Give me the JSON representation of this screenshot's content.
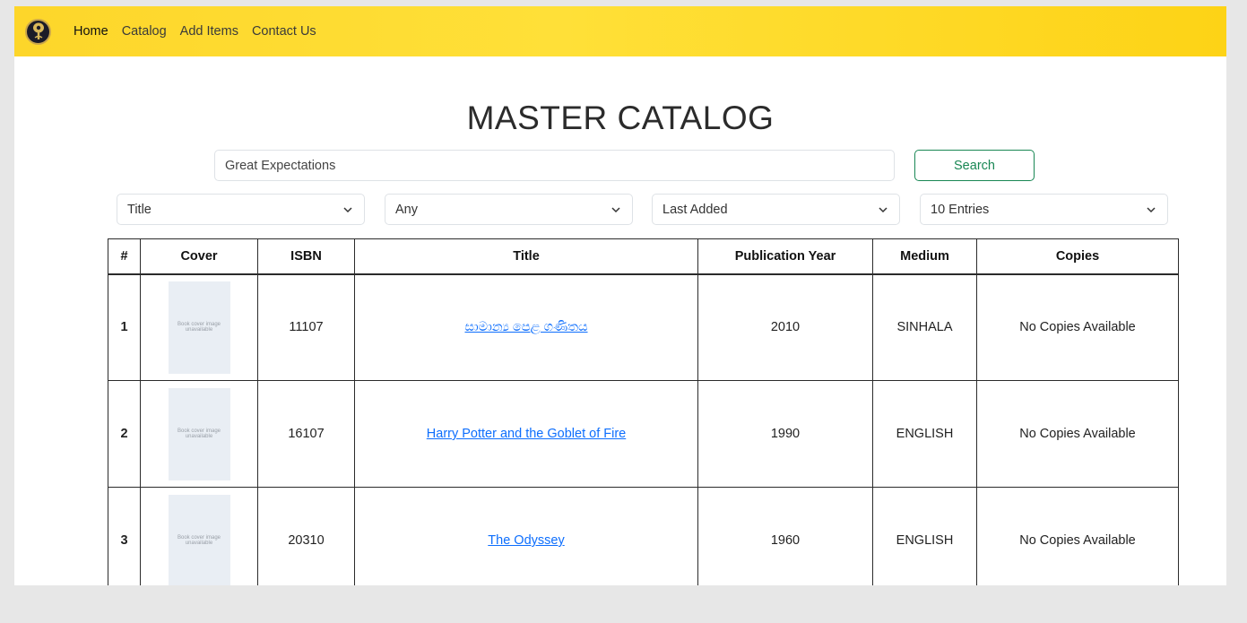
{
  "nav": {
    "links": [
      "Home",
      "Catalog",
      "Add Items",
      "Contact Us"
    ]
  },
  "page_title": "MASTER CATALOG",
  "search": {
    "value": "Great Expectations",
    "button_label": "Search"
  },
  "filters": {
    "search_by": "Title",
    "medium": "Any",
    "sort": "Last Added",
    "entries": "10 Entries"
  },
  "table": {
    "headers": [
      "#",
      "Cover",
      "ISBN",
      "Title",
      "Publication Year",
      "Medium",
      "Copies"
    ],
    "rows": [
      {
        "num": "1",
        "cover_text": "Book cover image unavailable",
        "isbn": "11107",
        "title": "සාමාන්‍ය පෙළ ගණිතය",
        "year": "2010",
        "medium": "SINHALA",
        "copies": "No Copies Available"
      },
      {
        "num": "2",
        "cover_text": "Book cover image unavailable",
        "isbn": "16107",
        "title": "Harry Potter and the Goblet of Fire",
        "year": "1990",
        "medium": "ENGLISH",
        "copies": "No Copies Available"
      },
      {
        "num": "3",
        "cover_text": "Book cover image unavailable",
        "isbn": "20310",
        "title": "The Odyssey",
        "year": "1960",
        "medium": "ENGLISH",
        "copies": "No Copies Available"
      }
    ]
  },
  "colors": {
    "navbar": "#fdd62a",
    "search_button": "#198754",
    "link": "#0d6efd"
  }
}
